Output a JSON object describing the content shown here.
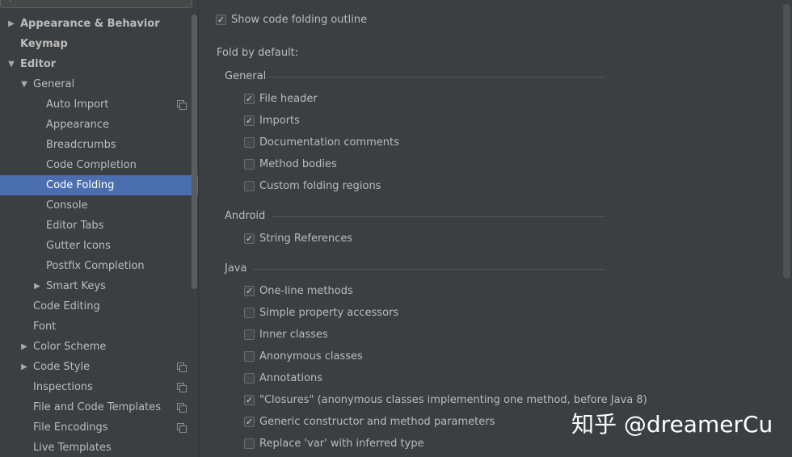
{
  "sidebar": {
    "search_icon": "search-icon",
    "items": [
      {
        "id": "appearance-behavior",
        "label": "Appearance & Behavior",
        "level": 0,
        "arrow": "right",
        "bold": true
      },
      {
        "id": "keymap",
        "label": "Keymap",
        "level": 0,
        "arrow": "",
        "bold": true
      },
      {
        "id": "editor",
        "label": "Editor",
        "level": 0,
        "arrow": "down",
        "bold": true
      },
      {
        "id": "general",
        "label": "General",
        "level": 1,
        "arrow": "down"
      },
      {
        "id": "auto-import",
        "label": "Auto Import",
        "level": 2,
        "arrow": "",
        "project_icon": true
      },
      {
        "id": "appearance",
        "label": "Appearance",
        "level": 2,
        "arrow": ""
      },
      {
        "id": "breadcrumbs",
        "label": "Breadcrumbs",
        "level": 2,
        "arrow": ""
      },
      {
        "id": "code-completion",
        "label": "Code Completion",
        "level": 2,
        "arrow": ""
      },
      {
        "id": "code-folding",
        "label": "Code Folding",
        "level": 2,
        "arrow": "",
        "selected": true
      },
      {
        "id": "console",
        "label": "Console",
        "level": 2,
        "arrow": ""
      },
      {
        "id": "editor-tabs",
        "label": "Editor Tabs",
        "level": 2,
        "arrow": ""
      },
      {
        "id": "gutter-icons",
        "label": "Gutter Icons",
        "level": 2,
        "arrow": ""
      },
      {
        "id": "postfix-completion",
        "label": "Postfix Completion",
        "level": 2,
        "arrow": ""
      },
      {
        "id": "smart-keys",
        "label": "Smart Keys",
        "level": 2,
        "arrow": "right"
      },
      {
        "id": "code-editing",
        "label": "Code Editing",
        "level": 1,
        "arrow": ""
      },
      {
        "id": "font",
        "label": "Font",
        "level": 1,
        "arrow": ""
      },
      {
        "id": "color-scheme",
        "label": "Color Scheme",
        "level": 1,
        "arrow": "right"
      },
      {
        "id": "code-style",
        "label": "Code Style",
        "level": 1,
        "arrow": "right",
        "project_icon": true
      },
      {
        "id": "inspections",
        "label": "Inspections",
        "level": 1,
        "arrow": "",
        "project_icon": true
      },
      {
        "id": "file-and-code-templates",
        "label": "File and Code Templates",
        "level": 1,
        "arrow": "",
        "project_icon": true
      },
      {
        "id": "file-encodings",
        "label": "File Encodings",
        "level": 1,
        "arrow": "",
        "project_icon": true
      },
      {
        "id": "live-templates",
        "label": "Live Templates",
        "level": 1,
        "arrow": ""
      }
    ]
  },
  "main": {
    "show_outline": {
      "label": "Show code folding outline",
      "checked": true
    },
    "fold_by_default_label": "Fold by default:",
    "groups": [
      {
        "id": "general",
        "title": "General",
        "options": [
          {
            "id": "file-header",
            "label": "File header",
            "checked": true
          },
          {
            "id": "imports",
            "label": "Imports",
            "checked": true
          },
          {
            "id": "documentation-comments",
            "label": "Documentation comments",
            "checked": false
          },
          {
            "id": "method-bodies",
            "label": "Method bodies",
            "checked": false
          },
          {
            "id": "custom-folding-regions",
            "label": "Custom folding regions",
            "checked": false
          }
        ]
      },
      {
        "id": "android",
        "title": "Android",
        "options": [
          {
            "id": "string-references",
            "label": "String References",
            "checked": true
          }
        ]
      },
      {
        "id": "java",
        "title": "Java",
        "options": [
          {
            "id": "one-line-methods",
            "label": "One-line methods",
            "checked": true
          },
          {
            "id": "simple-property-accessors",
            "label": "Simple property accessors",
            "checked": false
          },
          {
            "id": "inner-classes",
            "label": "Inner classes",
            "checked": false
          },
          {
            "id": "anonymous-classes",
            "label": "Anonymous classes",
            "checked": false
          },
          {
            "id": "annotations",
            "label": "Annotations",
            "checked": false
          },
          {
            "id": "closures",
            "label": "\"Closures\" (anonymous classes implementing one method, before Java 8)",
            "checked": true
          },
          {
            "id": "generic-constructor",
            "label": "Generic constructor and method parameters",
            "checked": true
          },
          {
            "id": "replace-var",
            "label": "Replace 'var' with inferred type",
            "checked": false
          }
        ]
      }
    ]
  },
  "watermark": "知乎 @dreamerCu",
  "colors": {
    "selection": "#4b6eaf",
    "background": "#3c3f41",
    "text": "#bbbbbb"
  }
}
